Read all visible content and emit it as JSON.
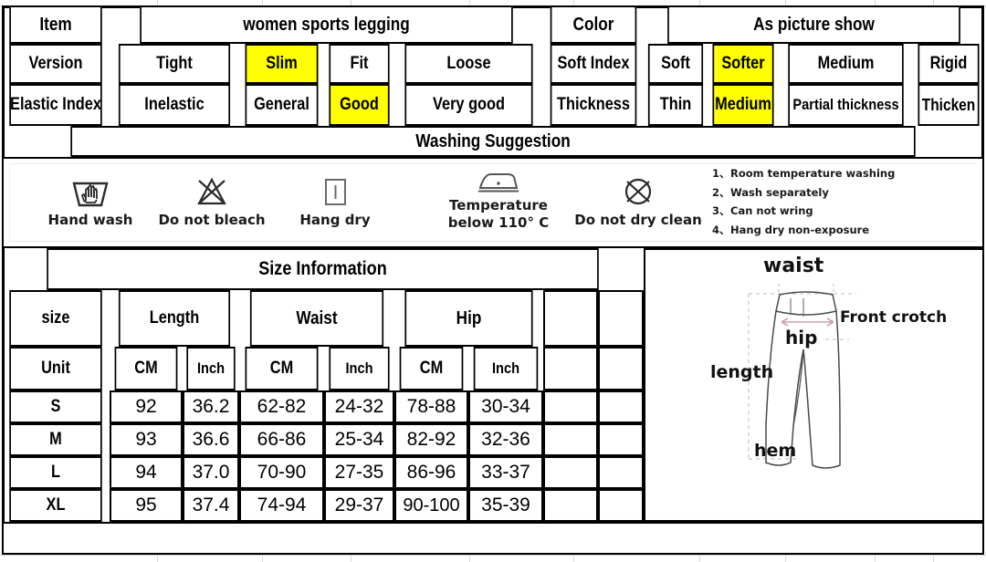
{
  "spec_table": {
    "rows": [
      {
        "label": "Item",
        "value": "women sports legging",
        "label2": "Color",
        "value2": "As picture show"
      }
    ],
    "version_row": {
      "label": "Version",
      "options": [
        "Tight",
        "Slim",
        "Fit",
        "Loose"
      ],
      "selected": "Slim",
      "label2": "Soft Index",
      "options2": [
        "Soft",
        "Softer",
        "Medium",
        "Rigid"
      ],
      "selected2": "Softer"
    },
    "elastic_row": {
      "label": "Elastic Index",
      "options": [
        "Inelastic",
        "General",
        "Good",
        "Very good"
      ],
      "selected": "Good",
      "label2": "Thickness",
      "options2": [
        "Thin",
        "Medium",
        "Partial thickness",
        "Thicken"
      ],
      "selected2": "Medium"
    }
  },
  "washing": {
    "title": "Washing Suggestion",
    "icons": [
      {
        "icon": "hand-wash-icon",
        "label": "Hand wash"
      },
      {
        "icon": "do-not-bleach-icon",
        "label": "Do not bleach"
      },
      {
        "icon": "hang-dry-icon",
        "label": "Hang dry"
      },
      {
        "icon": "iron-low-temperature-icon",
        "label_line1": "Temperature",
        "label_line2": "below 110° C"
      },
      {
        "icon": "do-not-dry-clean-icon",
        "label": "Do not dry clean"
      }
    ],
    "notes": [
      {
        "num": "1、",
        "text": "Room temperature washing"
      },
      {
        "num": "2、",
        "text": "Wash separately"
      },
      {
        "num": "3、",
        "text": "Can not wring"
      },
      {
        "num": "4、",
        "text": "Hang dry non-exposure"
      }
    ]
  },
  "size_info": {
    "title": "Size Information",
    "group_headers": [
      "size",
      "Length",
      "Waist",
      "Hip"
    ],
    "unit_headers": [
      "Unit",
      "CM",
      "Inch",
      "CM",
      "Inch",
      "CM",
      "Inch"
    ],
    "rows": [
      {
        "size": "S",
        "length_cm": "92",
        "length_inch": "36.2",
        "waist_cm": "62-82",
        "waist_inch": "24-32",
        "hip_cm": "78-88",
        "hip_inch": "30-34"
      },
      {
        "size": "M",
        "length_cm": "93",
        "length_inch": "36.6",
        "waist_cm": "66-86",
        "waist_inch": "25-34",
        "hip_cm": "82-92",
        "hip_inch": "32-36"
      },
      {
        "size": "L",
        "length_cm": "94",
        "length_inch": "37.0",
        "waist_cm": "70-90",
        "waist_inch": "27-35",
        "hip_cm": "86-96",
        "hip_inch": "33-37"
      },
      {
        "size": "XL",
        "length_cm": "95",
        "length_inch": "37.4",
        "waist_cm": "74-94",
        "waist_inch": "29-37",
        "hip_cm": "90-100",
        "hip_inch": "35-39"
      }
    ]
  },
  "diagram": {
    "name": "pants-measurement-diagram",
    "labels": {
      "waist": "waist",
      "front_crotch": "Front crotch",
      "hip": "hip",
      "length": "length",
      "hem": "hem"
    }
  },
  "colors": {
    "highlight": "#ffff00",
    "border": "#000000",
    "text": "#000000",
    "grid": "#d8d8d8",
    "arrow": "#c9a0b4"
  }
}
